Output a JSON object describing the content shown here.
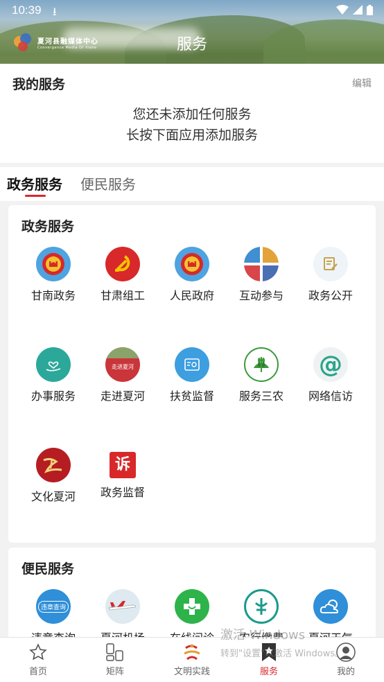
{
  "status_bar": {
    "time": "10:39"
  },
  "header": {
    "logo_cn": "夏河县融媒体中心",
    "logo_en": "Convergence Media Of Xiahe",
    "title": "服务"
  },
  "my_services": {
    "title": "我的服务",
    "edit_label": "编辑",
    "empty_line1": "您还未添加任何服务",
    "empty_line2": "长按下面应用添加服务"
  },
  "tabs": [
    {
      "label": "政务服务",
      "active": true
    },
    {
      "label": "便民服务",
      "active": false
    }
  ],
  "gov_section": {
    "title": "政务服务",
    "items": [
      {
        "label": "甘南政务",
        "icon": "national-emblem-icon"
      },
      {
        "label": "甘肃组工",
        "icon": "party-emblem-icon"
      },
      {
        "label": "人民政府",
        "icon": "national-emblem-icon"
      },
      {
        "label": "互动参与",
        "icon": "quadrant-icon"
      },
      {
        "label": "政务公开",
        "icon": "document-edit-icon"
      },
      {
        "label": "办事服务",
        "icon": "hand-heart-icon"
      },
      {
        "label": "走进夏河",
        "icon": "xiahe-banner-icon",
        "badge_text": "走进夏河"
      },
      {
        "label": "扶贫监督",
        "icon": "id-card-icon"
      },
      {
        "label": "服务三农",
        "icon": "wheat-icon"
      },
      {
        "label": "网络信访",
        "icon": "at-sign-icon",
        "glyph": "@"
      },
      {
        "label": "文化夏河",
        "icon": "culture-calligraphy-icon"
      },
      {
        "label": "政务监督",
        "icon": "complaint-icon",
        "glyph": "诉"
      }
    ]
  },
  "convenience_section": {
    "title": "便民服务",
    "items": [
      {
        "label": "违章查询",
        "icon": "violation-query-icon",
        "badge_text": "违章查询"
      },
      {
        "label": "夏河机场",
        "icon": "airplane-icon"
      },
      {
        "label": "在线问诊",
        "icon": "medical-cross-icon"
      },
      {
        "label": "农行缴费",
        "icon": "abc-bank-icon"
      },
      {
        "label": "夏河天气",
        "icon": "weather-cloud-icon"
      }
    ]
  },
  "bottom_nav": [
    {
      "label": "首页",
      "icon": "star-icon",
      "active": false
    },
    {
      "label": "矩阵",
      "icon": "matrix-icon",
      "active": false
    },
    {
      "label": "文明实践",
      "icon": "civilization-practice-icon",
      "active": false
    },
    {
      "label": "服务",
      "icon": "bookmark-star-icon",
      "active": true
    },
    {
      "label": "我的",
      "icon": "user-icon",
      "active": false
    }
  ],
  "watermark": {
    "line1": "激活 Windows",
    "line2": "转到\"设置\"以激活 Windows。"
  },
  "colors": {
    "accent": "#d8282a",
    "background": "#f2f2f2"
  }
}
